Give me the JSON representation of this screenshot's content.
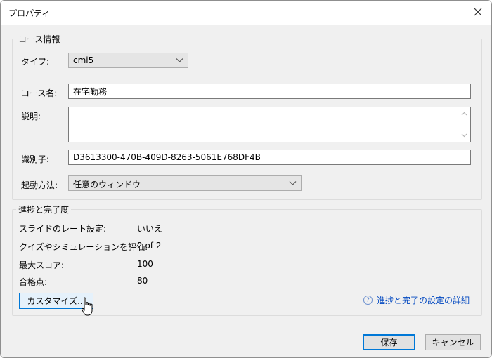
{
  "window": {
    "title": "プロパティ",
    "close_icon": "close-icon"
  },
  "course_info": {
    "group_label": "コース情報",
    "type_label": "タイプ:",
    "type_value": "cmi5",
    "name_label": "コース名:",
    "name_value": "在宅勤務",
    "description_label": "説明:",
    "description_value": "",
    "identifier_label": "識別子:",
    "identifier_value": "D3613300-470B-409D-8263-5061E768DF4B",
    "launch_label": "起動方法:",
    "launch_value": "任意のウィンドウ"
  },
  "progress": {
    "group_label": "進捗と完了度",
    "rows": [
      {
        "label": "スライドのレート設定:",
        "value": "いいえ"
      },
      {
        "label": "クイズやシミュレーションを評価:",
        "value": "2 of 2"
      },
      {
        "label": "最大スコア:",
        "value": "100"
      },
      {
        "label": "合格点:",
        "value": "80"
      }
    ],
    "customize_button": "カスタマイズ...",
    "help_link": "進捗と完了の設定の詳細",
    "help_icon_glyph": "?"
  },
  "footer": {
    "save_button": "保存",
    "cancel_button": "キャンセル"
  },
  "colors": {
    "accent": "#0078d7",
    "link": "#0047c0"
  }
}
